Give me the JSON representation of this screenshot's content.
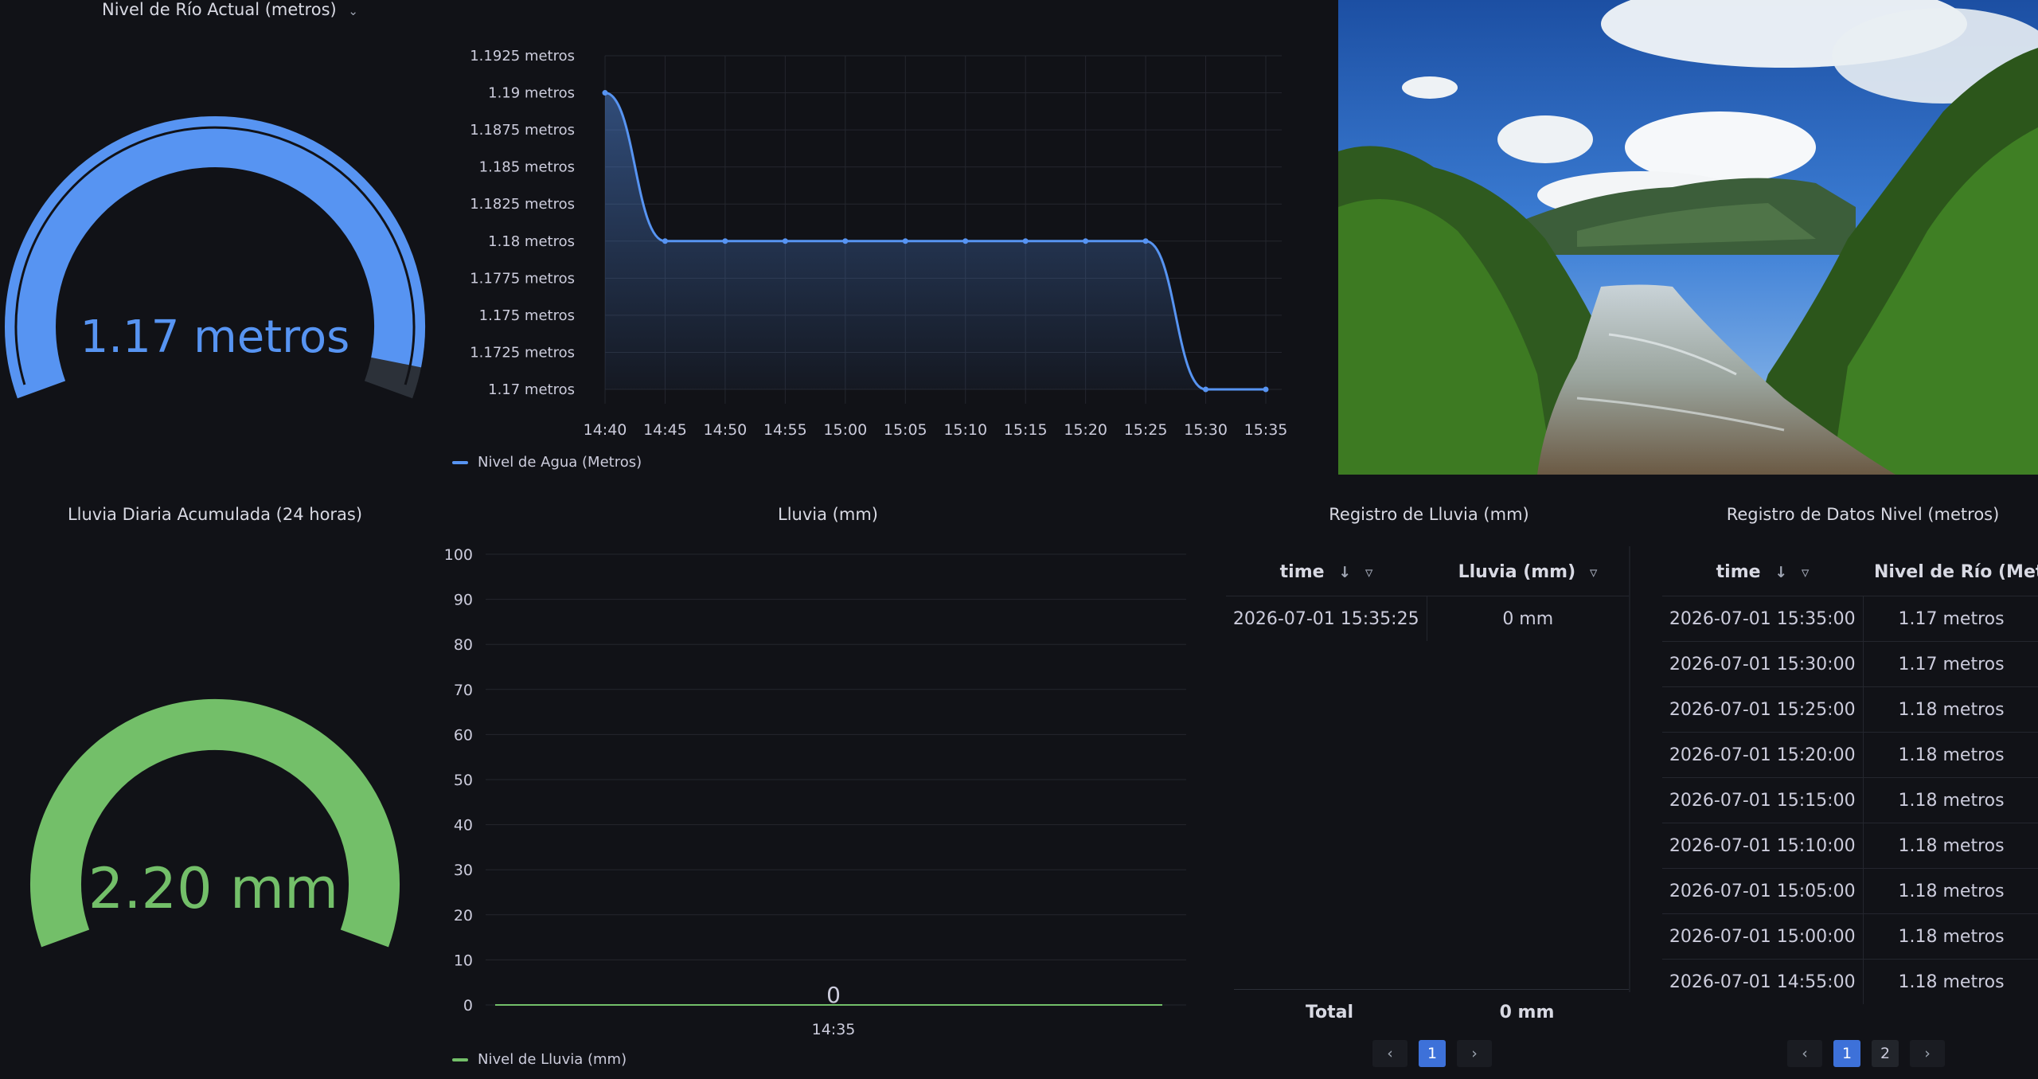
{
  "gauge_level": {
    "title": "Nivel de Río Actual (metros)",
    "value_text": "1.17 metros",
    "color": "#5794f2",
    "fraction": 0.96
  },
  "level_chart": {
    "legend": "Nivel de Agua (Metros)",
    "color": "#5794f2"
  },
  "gauge_rain": {
    "title": "Lluvia Diaria Acumulada (24 horas)",
    "value_text": "2.20 mm",
    "color": "#73bf69",
    "fraction": 1.0
  },
  "rain_chart": {
    "title": "Lluvia (mm)",
    "legend": "Nivel de Lluvia (mm)",
    "value_label": "0",
    "color": "#73bf69"
  },
  "rain_table": {
    "title": "Registro de Lluvia (mm)",
    "headers": [
      "time",
      "Lluvia (mm)"
    ],
    "rows": [
      [
        "2026-07-01 15:35:25",
        "0 mm"
      ]
    ],
    "footer": [
      "Total",
      "0 mm"
    ],
    "pages": [
      "1"
    ],
    "active_page": "1"
  },
  "level_table": {
    "title": "Registro de Datos Nivel (metros)",
    "headers": [
      "time",
      "Nivel de Río (Metros)"
    ],
    "rows": [
      [
        "2026-07-01 15:35:00",
        "1.17 metros"
      ],
      [
        "2026-07-01 15:30:00",
        "1.17 metros"
      ],
      [
        "2026-07-01 15:25:00",
        "1.18 metros"
      ],
      [
        "2026-07-01 15:20:00",
        "1.18 metros"
      ],
      [
        "2026-07-01 15:15:00",
        "1.18 metros"
      ],
      [
        "2026-07-01 15:10:00",
        "1.18 metros"
      ],
      [
        "2026-07-01 15:05:00",
        "1.18 metros"
      ],
      [
        "2026-07-01 15:00:00",
        "1.18 metros"
      ],
      [
        "2026-07-01 14:55:00",
        "1.18 metros"
      ]
    ],
    "pages": [
      "1",
      "2"
    ],
    "active_page": "1"
  },
  "chart_data": [
    {
      "type": "area",
      "title": "",
      "xlabel": "",
      "ylabel": "",
      "x": [
        "14:40",
        "14:45",
        "14:50",
        "14:55",
        "15:00",
        "15:05",
        "15:10",
        "15:15",
        "15:20",
        "15:25",
        "15:30",
        "15:35"
      ],
      "series": [
        {
          "name": "Nivel de Agua (Metros)",
          "values": [
            1.19,
            1.18,
            1.18,
            1.18,
            1.18,
            1.18,
            1.18,
            1.18,
            1.18,
            1.18,
            1.17,
            1.17
          ]
        }
      ],
      "y_ticks": [
        "1.1925 metros",
        "1.19 metros",
        "1.1875 metros",
        "1.185 metros",
        "1.1825 metros",
        "1.18 metros",
        "1.1775 metros",
        "1.175 metros",
        "1.1725 metros",
        "1.17 metros"
      ],
      "ylim": [
        1.17,
        1.1925
      ],
      "grid": true,
      "legend": "bottom-left"
    },
    {
      "type": "line",
      "title": "Lluvia (mm)",
      "xlabel": "",
      "ylabel": "",
      "x": [
        "14:35"
      ],
      "series": [
        {
          "name": "Nivel de Lluvia (mm)",
          "values": [
            0
          ]
        }
      ],
      "y_ticks": [
        "100",
        "90",
        "80",
        "70",
        "60",
        "50",
        "40",
        "30",
        "20",
        "10",
        "0"
      ],
      "ylim": [
        0,
        100
      ],
      "grid": true,
      "legend": "bottom-left"
    }
  ]
}
